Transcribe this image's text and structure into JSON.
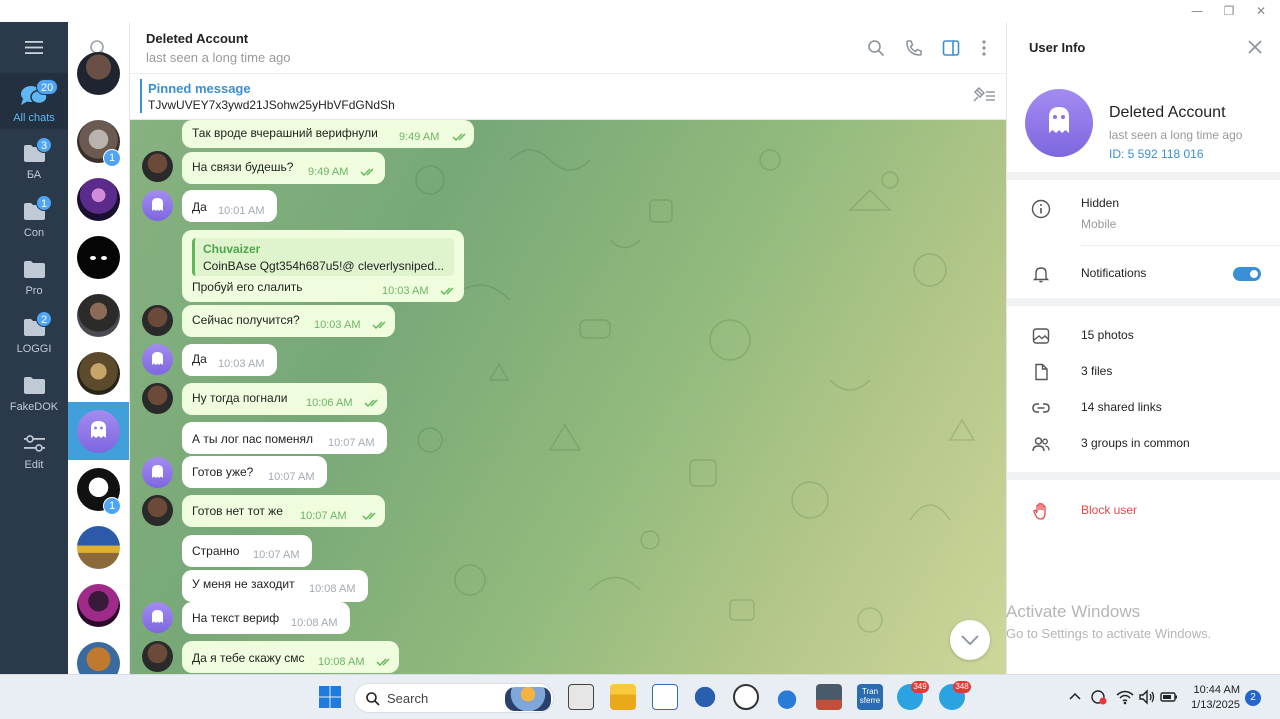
{
  "window": {
    "minimize": "—",
    "restore": "❐",
    "close": "✕"
  },
  "folders": [
    {
      "label": "All chats",
      "badge": "20"
    },
    {
      "label": "БА",
      "badge": "3"
    },
    {
      "label": "Con",
      "badge": "1"
    },
    {
      "label": "Pro",
      "badge": ""
    },
    {
      "label": "LOGGI",
      "badge": "2"
    },
    {
      "label": "FakeDOK",
      "badge": ""
    },
    {
      "label": "Edit",
      "badge": ""
    }
  ],
  "chatlist": {
    "badges": {
      "item2": "1",
      "item8": "1"
    }
  },
  "header": {
    "title": "Deleted Account",
    "status": "last seen a long time ago"
  },
  "pinned": {
    "title": "Pinned message",
    "text": "TJvwUVEY7x3ywd21JSohw25yHbVFdGNdSh"
  },
  "messages": [
    {
      "text": "Так вроде вчерашний верифнули",
      "time": "9:49 AM"
    },
    {
      "text": "На связи будешь?",
      "time": "9:49 AM"
    },
    {
      "text": "Да",
      "time": "10:01 AM"
    },
    {
      "reply_name": "Chuvaizer",
      "reply_text": "CoinBAse Qgt354h687u5!@ cleverlysniped...",
      "text": "Пробуй его слалить",
      "time": "10:03 AM"
    },
    {
      "text": "Сейчас получится?",
      "time": "10:03 AM"
    },
    {
      "text": "Да",
      "time": "10:03 AM"
    },
    {
      "text": "Ну тогда погнали",
      "time": "10:06 AM"
    },
    {
      "text": "А ты лог пас поменял",
      "time": "10:07 AM"
    },
    {
      "text": "Готов уже?",
      "time": "10:07 AM"
    },
    {
      "text": "Готов нет тот же",
      "time": "10:07 AM"
    },
    {
      "text": "Странно",
      "time": "10:07 AM"
    },
    {
      "text": "У меня не заходит",
      "time": "10:08 AM"
    },
    {
      "text": "На текст вериф",
      "time": "10:08 AM"
    },
    {
      "text": "Да я тебе скажу смс",
      "time": "10:08 AM"
    }
  ],
  "info": {
    "title": "User Info",
    "name": "Deleted Account",
    "seen": "last seen a long time ago",
    "id": "ID: 5 592 118 016",
    "phone_label": "Hidden",
    "phone_sub": "Mobile",
    "notifications": "Notifications",
    "notifications_on": true,
    "photos": "15 photos",
    "files": "3 files",
    "links": "14 shared links",
    "groups": "3 groups in common",
    "block": "Block user"
  },
  "watermark": {
    "line1": "Activate Windows",
    "line2": "Go to Settings to activate Windows."
  },
  "taskbar": {
    "search_label": "Search",
    "tele_badge1": "349",
    "tele_badge2": "348",
    "time": "10:44 AM",
    "date": "1/13/2025",
    "notif_count": "2",
    "transfer_label": "Tran sferre"
  },
  "colors": {
    "accent": "#3a8fd6",
    "outgoing": "#effdde",
    "sidebar": "#2b3a4a",
    "block": "#e5484d"
  }
}
